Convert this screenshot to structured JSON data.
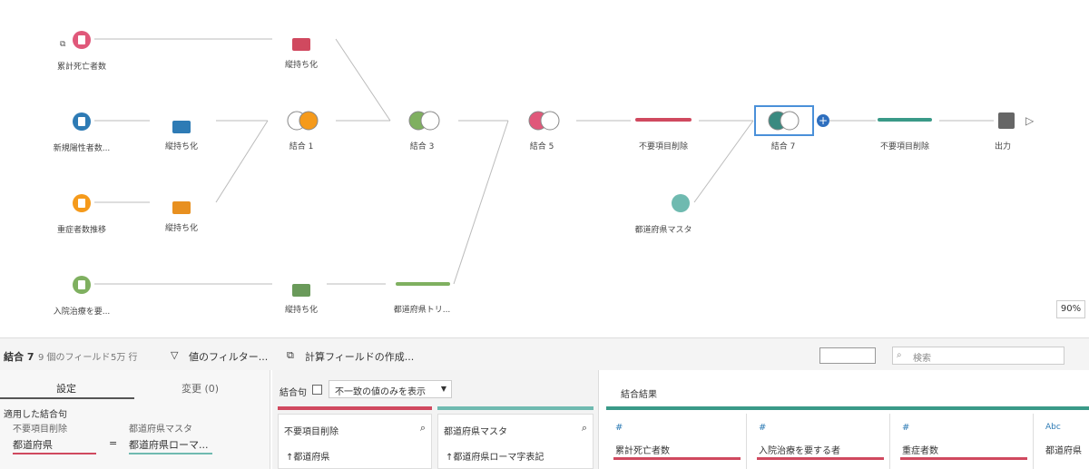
{
  "flow": {
    "nodes": {
      "cum_deaths": "累計死亡者数",
      "new_positive": "新規陽性者数...",
      "severe": "重症者数推移",
      "hospital": "入院治療を要...",
      "pivot1": "縦持ち化",
      "pivot2": "縦持ち化",
      "pivot3": "縦持ち化",
      "pivot4": "縦持ち化",
      "join1": "結合 1",
      "join3": "結合 3",
      "join5": "結合 5",
      "remove1": "不要項目削除",
      "pref_master": "都道府県マスタ",
      "join7": "結合 7",
      "remove2": "不要項目削除",
      "output": "出力",
      "pref_trim": "都道府県トリ..."
    },
    "zoom": "90%",
    "colors": {
      "pink": "#e0587a",
      "blue": "#2e7bb5",
      "orange": "#f59a1b",
      "green": "#7fb060",
      "teal": "#3aa090",
      "darkgreen": "#6a9a5a"
    }
  },
  "toolbar": {
    "step": "結合 7",
    "fields": "9 個のフィールド",
    "rows": "5万 行",
    "filter": "値のフィルター...",
    "calc": "計算フィールドの作成...",
    "search_placeholder": "検索"
  },
  "settings": {
    "tab_settings": "設定",
    "tab_changes": "変更 (0)",
    "applied_join": "適用した結合句",
    "left_name": "不要項目削除",
    "right_name": "都道府県マスタ",
    "left_field": "都道府県",
    "op": "=",
    "right_field": "都道府県ローマ..."
  },
  "join_clause": {
    "label": "結合句",
    "dropdown": "不一致の値のみを表示",
    "left_title": "不要項目削除",
    "left_field": "↑都道府県",
    "right_title": "都道府県マスタ",
    "right_field": "↑都道府県ローマ字表記"
  },
  "result": {
    "title": "結合結果",
    "columns": [
      {
        "type": "#",
        "name": "累計死亡者数"
      },
      {
        "type": "#",
        "name": "入院治療を要する者"
      },
      {
        "type": "#",
        "name": "重症者数"
      },
      {
        "type": "Abc",
        "name": "都道府県"
      }
    ]
  }
}
